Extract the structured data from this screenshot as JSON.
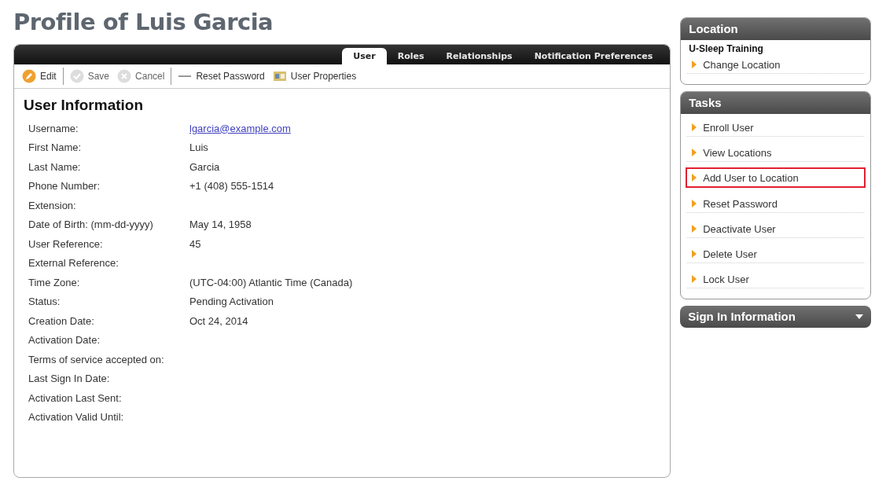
{
  "page_title": "Profile of Luis Garcia",
  "tabs": [
    {
      "label": "User",
      "selected": true
    },
    {
      "label": "Roles",
      "selected": false
    },
    {
      "label": "Relationships",
      "selected": false
    },
    {
      "label": "Notification Preferences",
      "selected": false
    }
  ],
  "toolbar": [
    {
      "label": "Edit",
      "kind": "edit",
      "disabled": false
    },
    {
      "label": "Save",
      "kind": "save",
      "disabled": true
    },
    {
      "label": "Cancel",
      "kind": "cancel",
      "disabled": true
    },
    {
      "label": "Reset Password",
      "kind": "reset",
      "disabled": false
    },
    {
      "label": "User Properties",
      "kind": "properties",
      "disabled": false
    }
  ],
  "section_title": "User Information",
  "fields": [
    {
      "label": "Username:",
      "value": "lgarcia@example.com",
      "kind": "link"
    },
    {
      "label": "First Name:",
      "value": "Luis",
      "kind": "text"
    },
    {
      "label": "Last Name:",
      "value": "Garcia",
      "kind": "text"
    },
    {
      "label": "Phone Number:",
      "value": "+1 (408) 555-1514",
      "kind": "text"
    },
    {
      "label": "Extension:",
      "kind": "text"
    },
    {
      "label": "Date of Birth: (mm-dd-yyyy)",
      "value": "May 14, 1958",
      "kind": "text"
    },
    {
      "label": "User Reference:",
      "value": "45",
      "kind": "text"
    },
    {
      "label": "External Reference:",
      "kind": "text"
    },
    {
      "label": "Time Zone:",
      "value": "(UTC-04:00) Atlantic Time (Canada)",
      "kind": "text"
    },
    {
      "label": "Status:",
      "value": "Pending Activation",
      "kind": "text"
    },
    {
      "label": "Creation Date:",
      "value": "Oct 24, 2014",
      "kind": "text"
    },
    {
      "label": "Activation Date:",
      "kind": "text"
    },
    {
      "label": "Terms of service accepted on:",
      "kind": "text"
    },
    {
      "label": "Last Sign In Date:",
      "kind": "text"
    },
    {
      "label": "Activation Last Sent:",
      "kind": "text"
    },
    {
      "label": "Activation Valid Until:",
      "kind": "text"
    }
  ],
  "location": {
    "title": "Location",
    "name": "U-Sleep Training",
    "links": [
      {
        "label": "Change Location",
        "highlighted": false
      }
    ]
  },
  "tasks": {
    "title": "Tasks",
    "links": [
      {
        "label": "Enroll User",
        "highlighted": false
      },
      {
        "label": "View Locations",
        "highlighted": false
      },
      {
        "label": "Add User to Location",
        "highlighted": true
      },
      {
        "label": "Reset Password",
        "highlighted": false
      },
      {
        "label": "Deactivate User",
        "highlighted": false
      },
      {
        "label": "Delete User",
        "highlighted": false
      },
      {
        "label": "Lock User",
        "highlighted": false
      }
    ]
  },
  "sign_in": {
    "title": "Sign In Information",
    "expanded": false
  }
}
